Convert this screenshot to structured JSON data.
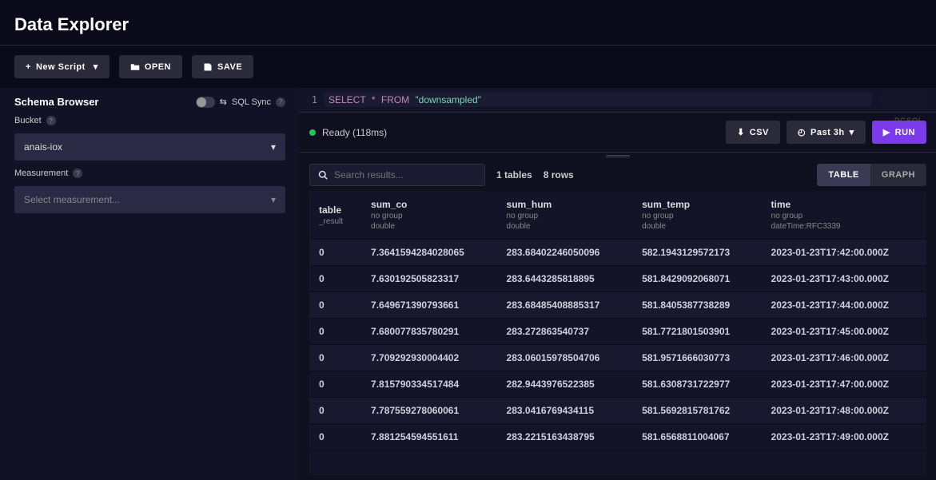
{
  "title": "Data Explorer",
  "toolbar": {
    "new_script": "New Script",
    "open": "OPEN",
    "save": "SAVE"
  },
  "sidebar": {
    "schema_title": "Schema Browser",
    "sql_sync": "SQL Sync",
    "bucket_label": "Bucket",
    "bucket_value": "anais-iox",
    "measurement_label": "Measurement",
    "measurement_placeholder": "Select measurement..."
  },
  "editor": {
    "line_num": "1",
    "kw_select": "SELECT",
    "star": "*",
    "kw_from": "FROM",
    "str_table": "\"downsampled\"",
    "lang_tag": "PGSQL"
  },
  "controls": {
    "status": "Ready (118ms)",
    "csv": "CSV",
    "time_range": "Past 3h",
    "run": "RUN"
  },
  "results": {
    "search_placeholder": "Search results...",
    "tables_count": "1 tables",
    "rows_count": "8 rows",
    "view_table": "TABLE",
    "view_graph": "GRAPH",
    "columns": [
      {
        "name": "table",
        "sub1": "_result",
        "sub2": ""
      },
      {
        "name": "sum_co",
        "sub1": "no group",
        "sub2": "double"
      },
      {
        "name": "sum_hum",
        "sub1": "no group",
        "sub2": "double"
      },
      {
        "name": "sum_temp",
        "sub1": "no group",
        "sub2": "double"
      },
      {
        "name": "time",
        "sub1": "no group",
        "sub2": "dateTime:RFC3339"
      }
    ],
    "rows": [
      [
        "0",
        "7.3641594284028065",
        "283.68402246050096",
        "582.1943129572173",
        "2023-01-23T17:42:00.000Z"
      ],
      [
        "0",
        "7.630192505823317",
        "283.6443285818895",
        "581.8429092068071",
        "2023-01-23T17:43:00.000Z"
      ],
      [
        "0",
        "7.649671390793661",
        "283.68485408885317",
        "581.8405387738289",
        "2023-01-23T17:44:00.000Z"
      ],
      [
        "0",
        "7.680077835780291",
        "283.272863540737",
        "581.7721801503901",
        "2023-01-23T17:45:00.000Z"
      ],
      [
        "0",
        "7.709292930004402",
        "283.06015978504706",
        "581.9571666030773",
        "2023-01-23T17:46:00.000Z"
      ],
      [
        "0",
        "7.815790334517484",
        "282.9443976522385",
        "581.6308731722977",
        "2023-01-23T17:47:00.000Z"
      ],
      [
        "0",
        "7.787559278060061",
        "283.0416769434115",
        "581.5692815781762",
        "2023-01-23T17:48:00.000Z"
      ],
      [
        "0",
        "7.881254594551611",
        "283.2215163438795",
        "581.6568811004067",
        "2023-01-23T17:49:00.000Z"
      ]
    ]
  }
}
